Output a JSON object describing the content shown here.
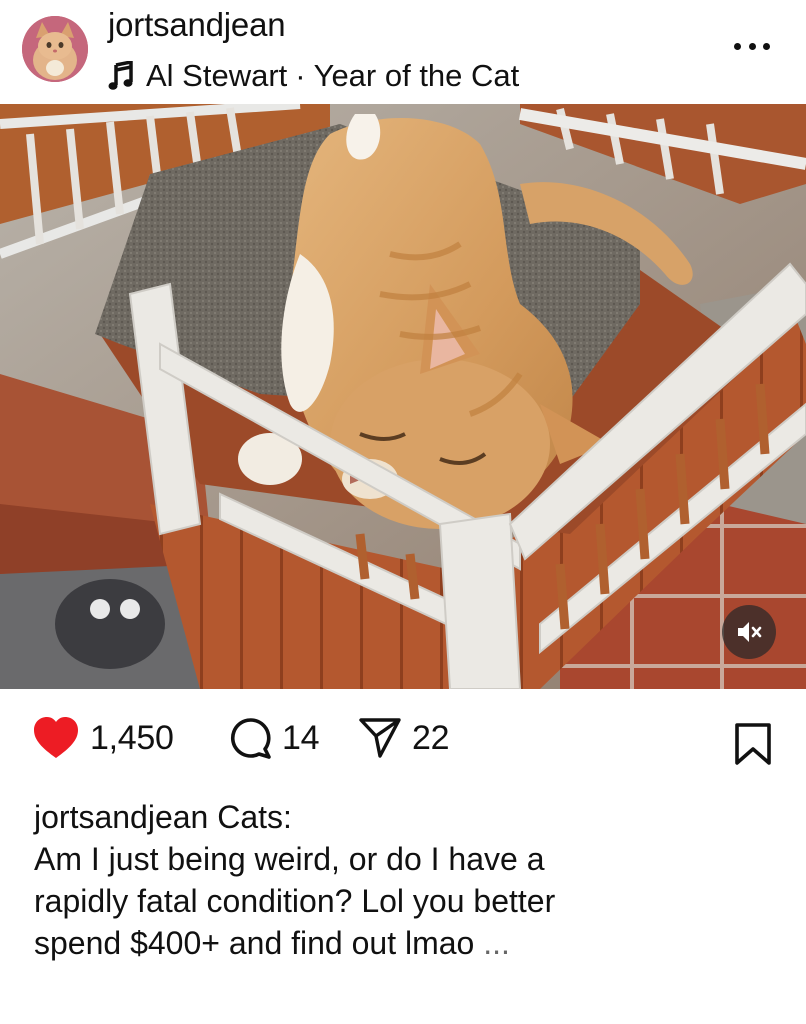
{
  "post": {
    "username": "jortsandjean",
    "music": {
      "icon": "music-note-icon",
      "artist": "Al Stewart",
      "separator": "·",
      "track": "Year of the Cat"
    },
    "more_icon": "more-options-icon",
    "mute_icon": "muted-speaker-icon"
  },
  "actions": {
    "likes": "1,450",
    "comments": "14",
    "shares": "22",
    "like_color": "#ed1c24"
  },
  "caption": {
    "username": "jortsandjean",
    "line1_rest": "Cats:",
    "line2": "Am I just being weird, or do I have a",
    "line3": "rapidly fatal condition? Lol you better",
    "line4_text": "spend $400+ and find out lmao",
    "line4_more": "..."
  }
}
